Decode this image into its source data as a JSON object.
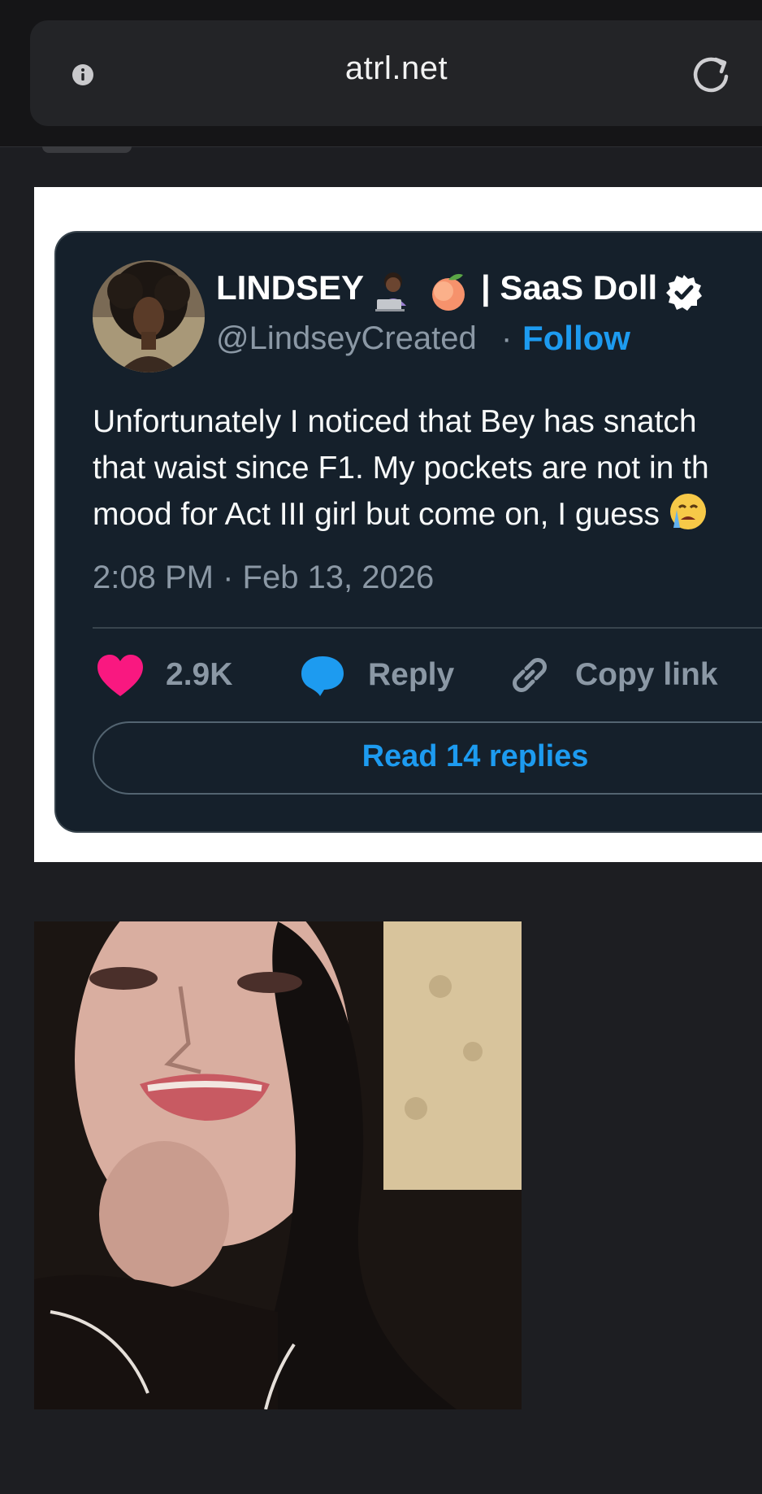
{
  "browser": {
    "url": "atrl.net",
    "info_icon": "info-icon",
    "reload_icon": "reload-icon"
  },
  "tweet": {
    "display_name": "LINDSEY",
    "name_emojis": [
      "woman-technologist-dark-skin-emoji",
      "peach-emoji"
    ],
    "name_suffix": "| SaaS Doll",
    "verified_icon": "verified-badge-icon",
    "handle": "@LindseyCreated",
    "separator": "·",
    "follow_label": "Follow",
    "text_lines": [
      "Unfortunately I noticed that Bey has snatch",
      "that waist since F1. My pockets are not in th",
      "mood for Act III girl but come on, I guess"
    ],
    "trailing_emoji": "loudly-crying-face-emoji",
    "timestamp": "2:08 PM · Feb 13, 2026",
    "like_count": "2.9K",
    "reply_label": "Reply",
    "copy_link_label": "Copy link",
    "read_replies_label": "Read 14 replies"
  },
  "colors": {
    "page_bg": "#1d1e22",
    "card_bg": "#15202b",
    "accent_blue": "#1d9bf0",
    "heart_pink": "#f91880",
    "muted_text": "#8b98a5"
  },
  "media": {
    "type": "gif",
    "icon": "animated-gif-image"
  }
}
